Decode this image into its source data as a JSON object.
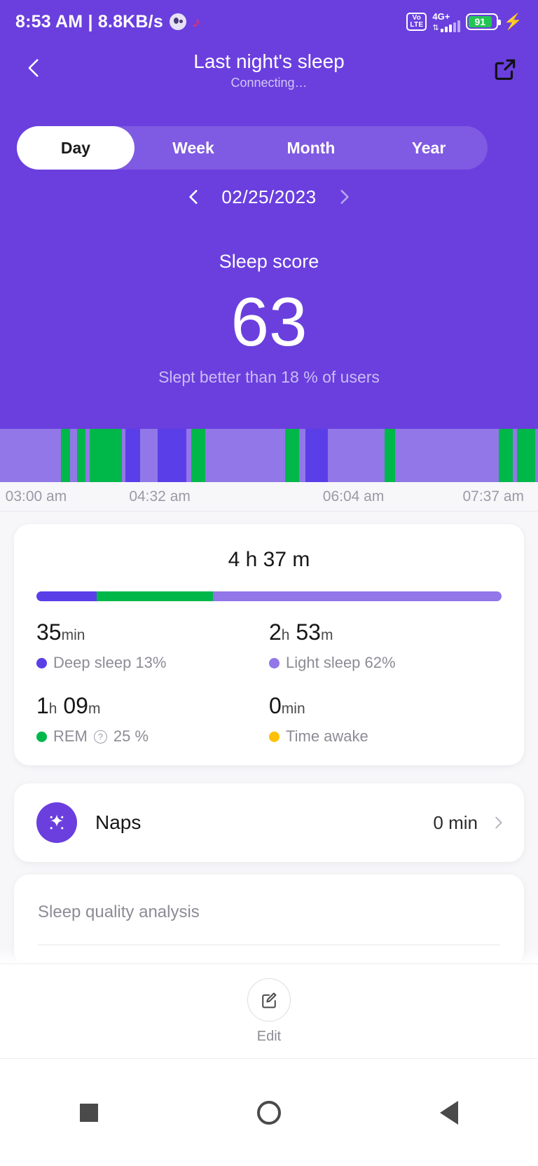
{
  "status_bar": {
    "clock_and_net": "8:53 AM | 8.8KB/s",
    "face_icon": "face-icon",
    "music_icon": "music-note-icon",
    "volte": "Vo\nLTE",
    "volte_top": "Vo",
    "volte_bottom": "LTE",
    "network": "4G+",
    "battery_level": "91",
    "charging_icon": "bolt-icon"
  },
  "header": {
    "back_icon": "back-chevron-icon",
    "title": "Last night's sleep",
    "subtitle": "Connecting…",
    "share_icon": "share-icon"
  },
  "tabs": {
    "items": [
      {
        "label": "Day",
        "active": true
      },
      {
        "label": "Week",
        "active": false
      },
      {
        "label": "Month",
        "active": false
      },
      {
        "label": "Year",
        "active": false
      }
    ]
  },
  "date_nav": {
    "prev_icon": "chevron-left-icon",
    "date": "02/25/2023",
    "next_icon": "chevron-right-icon"
  },
  "sleep_score": {
    "title": "Sleep score",
    "value": "63",
    "comparison": "Slept better than 18 % of users"
  },
  "colors": {
    "hero_purple": "#6A3FDE",
    "deep_sleep": "#5A3FE8",
    "light_sleep": "#9277E8",
    "rem": "#00B74A",
    "awake": "#FFC107",
    "accent": "#6A3FDE"
  },
  "chart_data": {
    "type": "bar",
    "title": "Sleep stages hypnogram",
    "xlabel": "",
    "ylabel": "",
    "grid": false,
    "legend_position": "below-in-card",
    "x_tick_labels": [
      "03:00 am",
      "04:32 am",
      "06:04 am",
      "07:37 am"
    ],
    "x_tick_positions_pct": [
      1,
      24,
      60,
      86
    ],
    "stage_colors": {
      "light": "#9277E8",
      "deep": "#5A3FE8",
      "rem": "#00B74A",
      "awake": "#FFC107"
    },
    "segments": [
      {
        "stage": "light",
        "width_pct": 11.3
      },
      {
        "stage": "rem",
        "width_pct": 1.7
      },
      {
        "stage": "light",
        "width_pct": 1.3
      },
      {
        "stage": "rem",
        "width_pct": 1.6
      },
      {
        "stage": "light",
        "width_pct": 0.8
      },
      {
        "stage": "rem",
        "width_pct": 5.9
      },
      {
        "stage": "light",
        "width_pct": 0.7
      },
      {
        "stage": "deep",
        "width_pct": 2.7
      },
      {
        "stage": "light",
        "width_pct": 3.3
      },
      {
        "stage": "deep",
        "width_pct": 5.3
      },
      {
        "stage": "light",
        "width_pct": 1.0
      },
      {
        "stage": "rem",
        "width_pct": 2.5
      },
      {
        "stage": "light",
        "width_pct": 14.9
      },
      {
        "stage": "rem",
        "width_pct": 2.6
      },
      {
        "stage": "light",
        "width_pct": 1.2
      },
      {
        "stage": "deep",
        "width_pct": 4.2
      },
      {
        "stage": "light",
        "width_pct": 10.5
      },
      {
        "stage": "rem",
        "width_pct": 1.9
      },
      {
        "stage": "light",
        "width_pct": 19.3
      },
      {
        "stage": "rem",
        "width_pct": 2.6
      },
      {
        "stage": "light",
        "width_pct": 0.8
      },
      {
        "stage": "rem",
        "width_pct": 3.4
      },
      {
        "stage": "light",
        "width_pct": 0.5
      }
    ],
    "summary": {
      "total": "4 h 37 m",
      "distribution_pct": {
        "deep": 13,
        "rem": 25,
        "light": 62
      },
      "stats": [
        {
          "value": "35",
          "unit": " min",
          "label": "Deep sleep 13%",
          "color": "#5A3FE8",
          "has_info_icon": false
        },
        {
          "value": "2 h 53 m",
          "unit": "",
          "label": "Light sleep 62%",
          "color": "#9277E8",
          "has_info_icon": false
        },
        {
          "value": "1 h 09 m",
          "unit": "",
          "label": "REM",
          "label_suffix": "25 %",
          "color": "#00B74A",
          "has_info_icon": true
        },
        {
          "value": "0",
          "unit": " min",
          "label": "Time awake",
          "color": "#FFC107",
          "has_info_icon": false
        }
      ]
    }
  },
  "sleep_card": {
    "total": "4 h 37 m",
    "deep_value_num": "35",
    "deep_value_unit": "min",
    "deep_label": "Deep sleep 13%",
    "light_value_h": "2",
    "light_value_h_u": "h",
    "light_value_m": "53",
    "light_value_m_u": "m",
    "light_label": "Light sleep 62%",
    "rem_value_h": "1",
    "rem_value_h_u": "h",
    "rem_value_m": "09",
    "rem_value_m_u": "m",
    "rem_label": "REM",
    "rem_pct": "25 %",
    "rem_info_icon": "info-question-icon",
    "awake_value_num": "0",
    "awake_value_unit": "min",
    "awake_label": "Time awake"
  },
  "naps_card": {
    "icon": "naps-sparkle-icon",
    "label": "Naps",
    "value": "0 min",
    "chevron": "chevron-right-icon"
  },
  "quality_card": {
    "title": "Sleep quality analysis"
  },
  "bottom_bar": {
    "edit_icon": "edit-pencil-square-icon",
    "edit_label": "Edit"
  },
  "nav_bar": {
    "recents_icon": "square-recents-icon",
    "home_icon": "circle-home-icon",
    "back_icon": "triangle-back-icon"
  }
}
